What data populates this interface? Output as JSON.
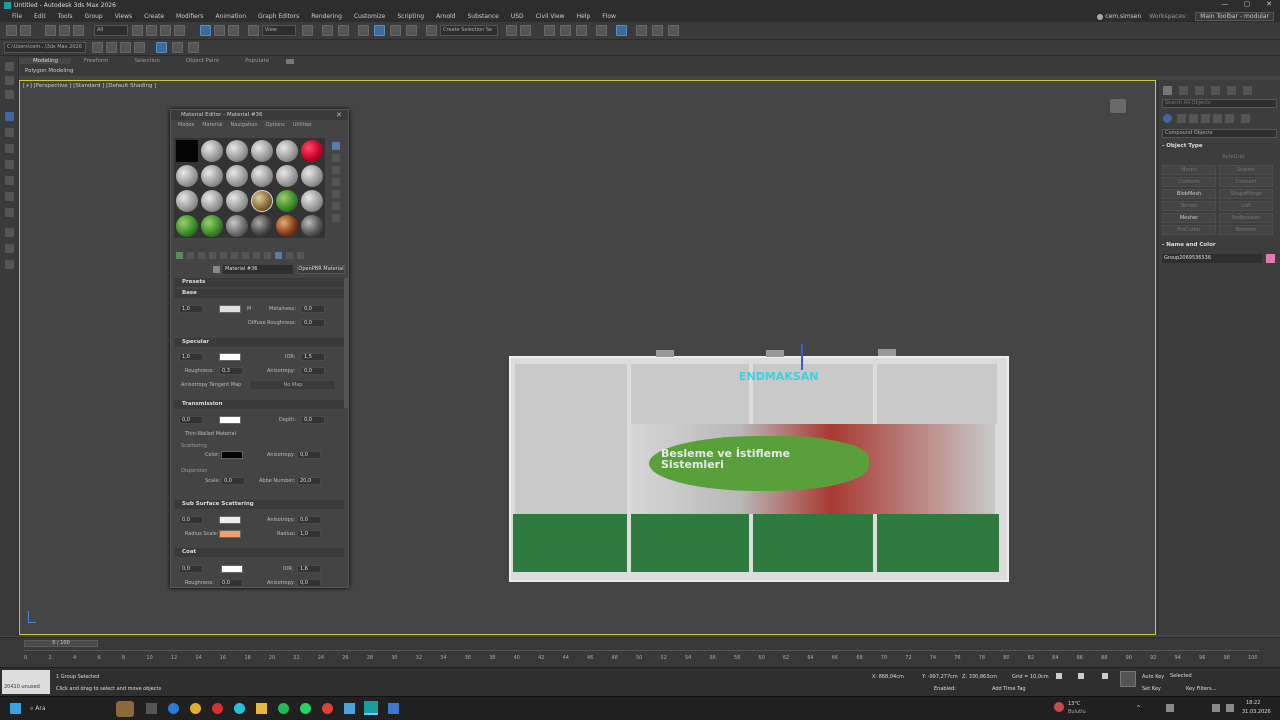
{
  "window": {
    "title": "Untitled - Autodesk 3ds Max 2026",
    "controls": [
      "—",
      "▢",
      "✕"
    ]
  },
  "menus": [
    "File",
    "Edit",
    "Tools",
    "Group",
    "Views",
    "Create",
    "Modifiers",
    "Animation",
    "Graph Editors",
    "Rendering",
    "Customize",
    "Scripting",
    "Arnold",
    "Substance",
    "USD",
    "Civil View",
    "Help",
    "Flow"
  ],
  "user": {
    "name": "cem.simsen",
    "workspaces_label": "Workspaces:",
    "workspace": "Main Toolbar - modular"
  },
  "toolbar": {
    "filter_all": "All",
    "view_dropdown": "View",
    "selection_set": "Create Selection Se"
  },
  "toolbar2": {
    "path": "C:\\Users\\cem...\\3ds Max 2026"
  },
  "ribbon": {
    "tabs": [
      "Modeling",
      "Freeform",
      "Selection",
      "Object Paint",
      "Populate"
    ],
    "active": "Modeling",
    "subtitle": "Polygon Modeling"
  },
  "viewport": {
    "label": "[+] [Perspective ] [Standard ] [Default Shading ]"
  },
  "model": {
    "sign_text": "ENDMAKSAN",
    "banner_text": "Besleme ve İstifleme Sistemleri"
  },
  "command_panel": {
    "search_placeholder": "Search All Objects",
    "category": "Compound Objects",
    "object_type_header": "Object Type",
    "autogrid": "AutoGrid",
    "buttons": [
      "Morph",
      "Scatter",
      "Conform",
      "Connect",
      "BlobMesh",
      "ShapeMerge",
      "Terrain",
      "Loft",
      "Mesher",
      "ProBoolean",
      "ProCutter",
      "Boolean"
    ],
    "enabled_buttons": [
      "BlobMesh",
      "Mesher"
    ],
    "name_color_header": "Name and Color",
    "object_name": "Group2069536536",
    "object_color": "#e07ab0"
  },
  "material_editor": {
    "title": "Material Editor - Material #36",
    "menu": [
      "Modes",
      "Material",
      "Navigation",
      "Options",
      "Utilities"
    ],
    "material_name": "Material #36",
    "material_type": "OpenPBR Material",
    "sections": {
      "presets": "Presets",
      "base": "Base",
      "specular": "Specular",
      "transmission": "Transmission",
      "sss": "Sub Surface Scattering",
      "coat": "Coat"
    },
    "base": {
      "weight": "1,0",
      "metalness_label": "Metalness:",
      "metalness": "0,0",
      "diffuse_roughness_label": "Diffuse Roughness:",
      "diffuse_roughness": "0,0",
      "map_btn": "M"
    },
    "specular": {
      "weight": "1,0",
      "ior_label": "IOR:",
      "ior": "1,5",
      "roughness_label": "Roughness:",
      "roughness": "0,3",
      "anisotropy_label": "Anisotropy:",
      "anisotropy": "0,0",
      "tangent_map": "Anisotropy Tangent Map",
      "no_map": "No Map"
    },
    "transmission": {
      "weight": "0,0",
      "depth_label": "Depth:",
      "depth": "0,0",
      "thin_walled": "Thin-Walled Material",
      "scattering_label": "Scattering",
      "color_label": "Color:",
      "anisotropy_label": "Anisotropy:",
      "anisotropy": "0,0",
      "dispersion_label": "Dispersion",
      "scale_label": "Scale:",
      "scale": "0,0",
      "abbe_label": "Abbe Number:",
      "abbe": "20,0"
    },
    "sss": {
      "weight": "0,0",
      "anisotropy_label": "Anisotropy:",
      "anisotropy": "0,0",
      "radius_scale_label": "Radius Scale:",
      "radius_label": "Radius:",
      "radius": "1,0"
    },
    "coat": {
      "weight": "0,0",
      "ior_label": "IOR:",
      "ior": "1,6",
      "roughness_label": "Roughness:",
      "roughness": "0,0",
      "anisotropy_label": "Anisotropy:",
      "anisotropy": "0,0"
    }
  },
  "timeline": {
    "frame_display": "0 / 100",
    "ticks": [
      "0",
      "2",
      "4",
      "6",
      "8",
      "10",
      "12",
      "14",
      "16",
      "18",
      "20",
      "22",
      "24",
      "26",
      "28",
      "30",
      "32",
      "34",
      "36",
      "38",
      "40",
      "42",
      "44",
      "46",
      "48",
      "50",
      "52",
      "54",
      "56",
      "58",
      "60",
      "62",
      "64",
      "66",
      "68",
      "70",
      "72",
      "74",
      "76",
      "78",
      "80",
      "82",
      "84",
      "86",
      "88",
      "90",
      "92",
      "94",
      "96",
      "98",
      "100"
    ]
  },
  "status": {
    "selected": "1 Group Selected",
    "hint": "Click and drag to select and move objects",
    "maxscript": "20410 unused",
    "x": "X: 868,04cm",
    "y": "Y: -997,277cm",
    "z": "Z: 330,863cm",
    "grid": "Grid = 10,0cm",
    "enabled": "Enabled:",
    "add_time_tag": "Add Time Tag",
    "auto_key": "Auto Key",
    "set_key": "Set Key",
    "selected_dd": "Selected",
    "key_filters": "Key Filters..."
  },
  "taskbar": {
    "search": "Ara",
    "weather_temp": "13°C",
    "weather_desc": "Bulutlu",
    "time": "18:22",
    "date": "31.03.2026"
  }
}
